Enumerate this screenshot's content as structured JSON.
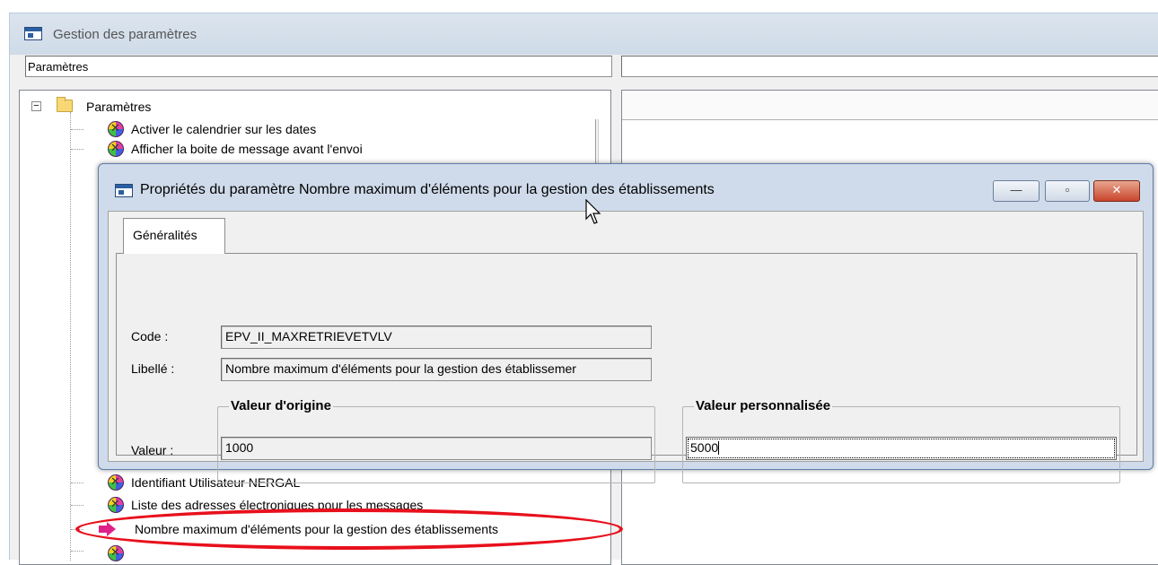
{
  "main_window": {
    "title": "Gestion des paramètres"
  },
  "columns": {
    "left_header": "Paramètres",
    "right_header": ""
  },
  "tree": {
    "root_label": "Paramètres",
    "expander_symbol": "−",
    "items_top": [
      {
        "label": "Activer le calendrier sur les dates",
        "icon": "parameter-icon"
      },
      {
        "label": "Afficher la boite de message avant l'envoi",
        "icon": "parameter-icon"
      }
    ],
    "items_bottom": [
      {
        "label": "Identifiant Utilisateur NERGAL",
        "icon": "parameter-icon"
      },
      {
        "label": "Liste des adresses électroniques pour les messages",
        "icon": "parameter-icon"
      },
      {
        "label": "Nombre maximum d'éléments pour la gestion des établissements",
        "icon": "selected-arrow-icon",
        "selected": true
      }
    ]
  },
  "dialog": {
    "title": "Propriétés du paramètre Nombre maximum d'éléments pour la gestion des établissements",
    "buttons": {
      "minimize": "—",
      "maximize": "▫",
      "close": "✕"
    },
    "tab_label": "Généralités",
    "code_label": "Code :",
    "code_value": "EPV_II_MAXRETRIEVETVLV",
    "libelle_label": "Libellé :",
    "libelle_value": "Nombre maximum d'éléments pour la gestion des établissemer",
    "valeur_label": "Valeur :",
    "origin_group_title": "Valeur d'origine",
    "origin_value": "1000",
    "custom_group_title": "Valeur personnalisée",
    "custom_value": "5000"
  },
  "colors": {
    "annotation": "#e8101c",
    "dialog_frame": "#cfdbea",
    "selected_arrow": "#e0208a"
  }
}
